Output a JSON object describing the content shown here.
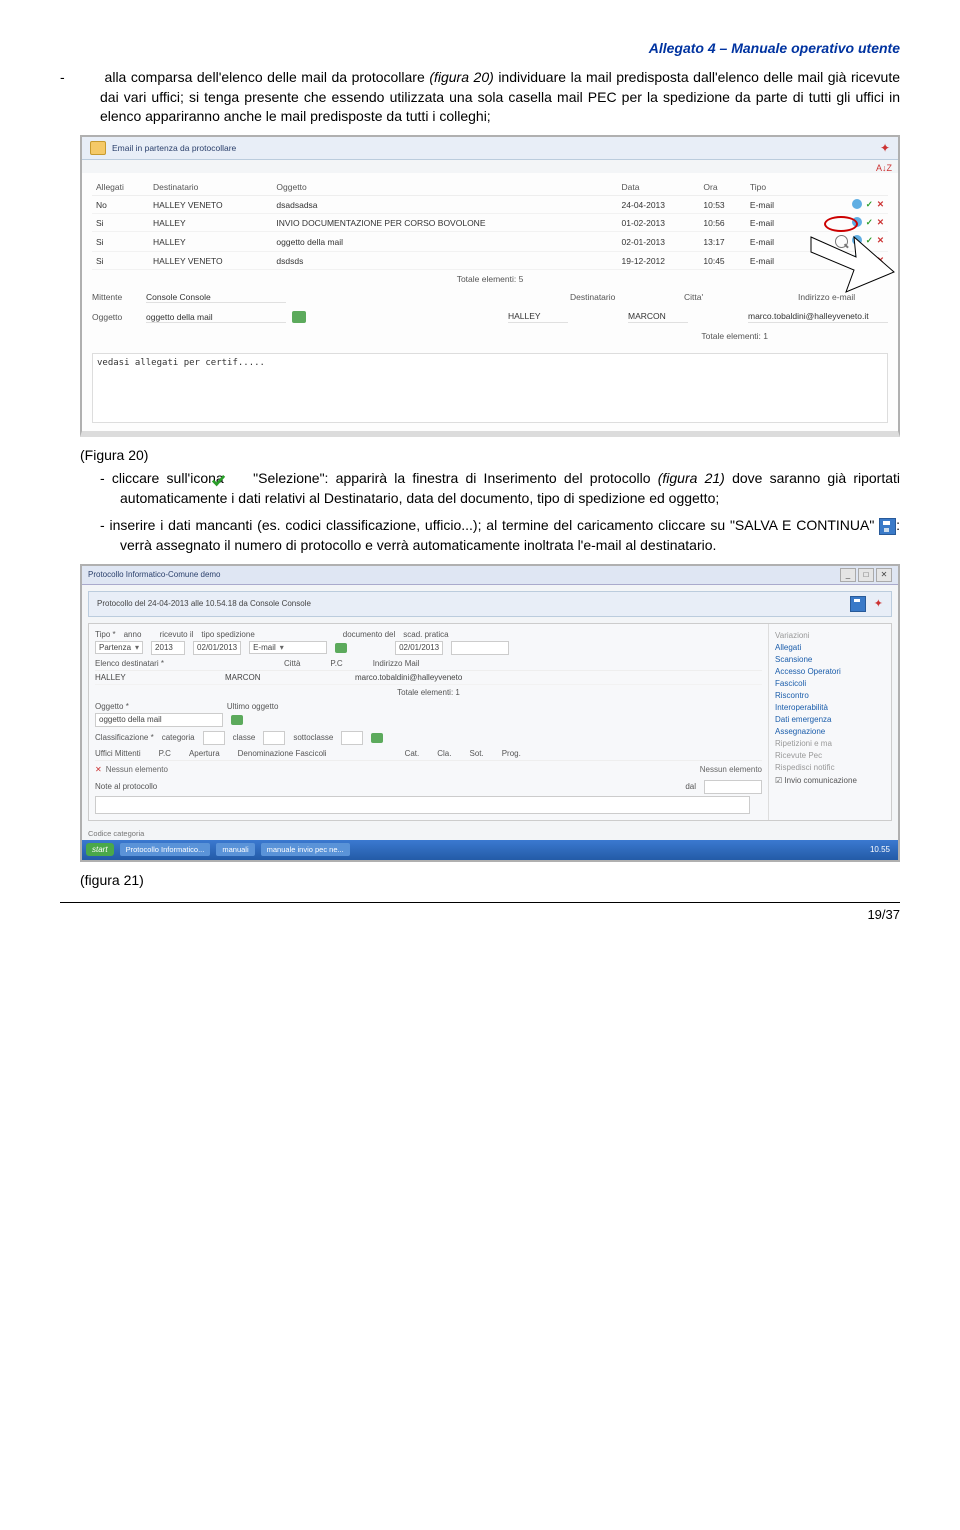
{
  "header": {
    "title": "Allegato 4 – Manuale operativo utente"
  },
  "p1": {
    "prefix": "alla comparsa dell'elenco delle mail da protocollare ",
    "figref": "(figura 20)",
    "rest": " individuare la mail predisposta dall'elenco delle mail già ricevute dai vari uffici; si tenga presente che essendo utilizzata una sola casella mail PEC per la spedizione da parte di tutti gli uffici in elenco appariranno anche le mail predisposte da tutti i colleghi;"
  },
  "fig20": {
    "label": "(Figura 20)",
    "barTitle": "Email in partenza da protocollare",
    "az": "A↓Z",
    "headers": {
      "allegati": "Allegati",
      "destinatario": "Destinatario",
      "oggetto": "Oggetto",
      "data": "Data",
      "ora": "Ora",
      "tipo": "Tipo"
    },
    "rows": [
      {
        "a": "No",
        "d": "HALLEY VENETO",
        "o": "dsadsadsa",
        "dt": "24-04-2013",
        "or": "10:53",
        "t": "E-mail"
      },
      {
        "a": "Si",
        "d": "HALLEY",
        "o": "INVIO DOCUMENTAZIONE PER CORSO BOVOLONE",
        "dt": "01-02-2013",
        "or": "10:56",
        "t": "E-mail"
      },
      {
        "a": "Si",
        "d": "HALLEY",
        "o": "oggetto della mail",
        "dt": "02-01-2013",
        "or": "13:17",
        "t": "E-mail"
      },
      {
        "a": "Si",
        "d": "HALLEY VENETO",
        "o": "dsdsds",
        "dt": "19-12-2012",
        "or": "10:45",
        "t": "E-mail"
      }
    ],
    "totalTop": "Totale elementi: 5",
    "mittenteLbl": "Mittente",
    "mittenteVal": "Console Console",
    "oggettoLbl": "Oggetto",
    "oggettoVal": "oggetto della mail",
    "destLbl": "Destinatario",
    "cittaLbl": "Citta'",
    "indirLbl": "Indirizzo e-mail",
    "destVal": "HALLEY",
    "cittaVal": "MARCON",
    "indirVal": "marco.tobaldini@halleyveneto.it",
    "totalBottom": "Totale elementi: 1",
    "msg": "vedasi allegati per certif....."
  },
  "p2": {
    "prefix": "cliccare sull'icona ",
    "after": " \"Selezione\": apparirà la finestra di Inserimento del protocollo ",
    "figref": "(figura 21)",
    "rest": " dove saranno già riportati automaticamente i dati relativi al Destinatario, data del documento, tipo di spedizione ed oggetto;"
  },
  "p3": {
    "part1": "inserire i dati mancanti (es. codici classificazione, ufficio...); al termine del caricamento cliccare su \"SALVA E CONTINUA\" ",
    "part2": ": verrà assegnato il numero di protocollo e verrà automaticamente inoltrata l'e-mail al destinatario."
  },
  "fig21": {
    "winTitle": "Protocollo Informatico-Comune demo",
    "panelText": "Protocollo del 24-04-2013 alle 10.54.18 da Console Console",
    "labels": {
      "tipo": "Tipo *",
      "anno": "anno",
      "ricevuto": "ricevuto il",
      "tipoSped": "tipo spedizione",
      "docDel": "documento del",
      "scadPratica": "scad. pratica",
      "elencoDest": "Elenco destinatari *",
      "citta": "Città",
      "pc": "P.C",
      "indirizzoMail": "Indirizzo Mail",
      "oggetto": "Oggetto *",
      "ultimoOggetto": "Ultimo oggetto",
      "classificazione": "Classificazione *",
      "categoria": "categoria",
      "classe": "classe",
      "sottoclasse": "sottoclasse",
      "uffMitt": "Uffici Mittenti",
      "pcCol": "P.C",
      "apertura": "Apertura",
      "denom": "Denominazione Fascicoli",
      "cat": "Cat.",
      "cla": "Cla.",
      "sot": "Sot.",
      "prog": "Prog.",
      "noteProt": "Note al protocollo",
      "dal": "dal"
    },
    "values": {
      "tipo": "Partenza",
      "anno": "2013",
      "ricevuto": "02/01/2013",
      "tipoSped": "E-mail",
      "docDel": "02/01/2013",
      "dest": "HALLEY",
      "citta": "MARCON",
      "indirMail": "marco.tobaldini@halleyveneto",
      "totale": "Totale elementi: 1",
      "oggetto": "oggetto della mail",
      "nessun1": "Nessun elemento",
      "nessun2": "Nessun elemento"
    },
    "side": {
      "variazioni": "Variazioni",
      "allegati": "Allegati",
      "scansione": "Scansione",
      "accesso": "Accesso Operatori",
      "fascicoli": "Fascicoli",
      "riscontro": "Riscontro",
      "interop": "Interoperabilità",
      "datiEmerg": "Dati emergenza",
      "assegnazione": "Assegnazione",
      "ripetizioni": "Ripetizioni e ma",
      "ricevute": "Ricevute Pec",
      "rispedisci": "Rispedisci notific",
      "invioComm": "Invio comunicazione"
    },
    "footer": "Codice categoria",
    "taskbar": {
      "start": "start",
      "t1": "Protocollo Informatico...",
      "t2": "manuali",
      "t3": "manuale invio pec ne...",
      "clock": "10.55"
    },
    "label": "(figura 21)"
  },
  "page": "19/37"
}
